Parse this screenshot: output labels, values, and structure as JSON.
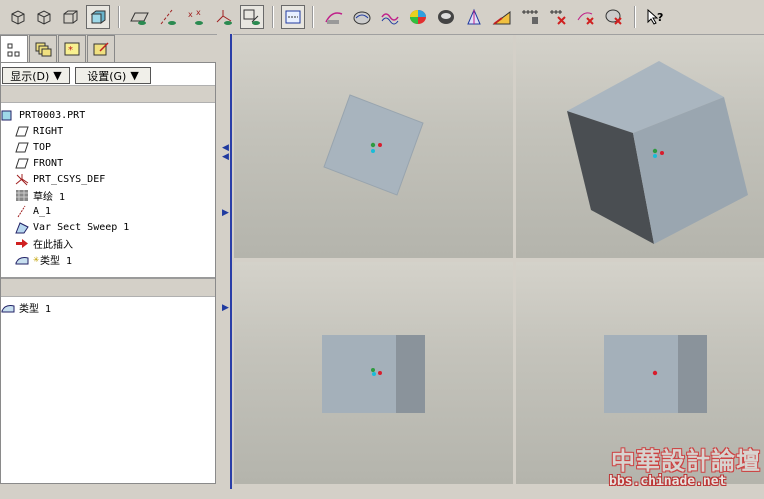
{
  "toolbar": {
    "items": [
      "view-iso-icon",
      "view-iso2-icon",
      "wireframe-icon",
      "shaded-icon",
      "datum-planes-icon",
      "datum-axes-icon",
      "datum-points-icon",
      "csys-icon",
      "spin-center-icon",
      "window-layout-icon",
      "sketch-tool-icon",
      "curve-analysis-icon",
      "curvature-icon",
      "shade-analysis-icon",
      "dihedral-icon",
      "draft-icon",
      "slope-icon",
      "measure-icon",
      "delete-analysis-icon",
      "delete-all-icon",
      "whats-this-help-icon"
    ]
  },
  "tabs": [
    "model-tree-tab",
    "layers-tab",
    "favorites-tab",
    "web-tab"
  ],
  "panel": {
    "display_label": "显示(D)",
    "settings_label": "设置(G)"
  },
  "tree": [
    {
      "label": "PRT0003.PRT",
      "icon": "part-icon"
    },
    {
      "label": "RIGHT",
      "icon": "datum-plane-icon"
    },
    {
      "label": "TOP",
      "icon": "datum-plane-icon"
    },
    {
      "label": "FRONT",
      "icon": "datum-plane-icon"
    },
    {
      "label": "PRT_CSYS_DEF",
      "icon": "csys-icon"
    },
    {
      "label": "草绘 1",
      "icon": "sketch-icon"
    },
    {
      "label": "A_1",
      "icon": "axis-icon"
    },
    {
      "label": "Var Sect Sweep 1",
      "icon": "sweep-icon"
    },
    {
      "label": "在此插入",
      "icon": "insert-here-icon"
    },
    {
      "label": "类型 1",
      "icon": "surface-type-icon"
    }
  ],
  "lower_list": [
    {
      "label": "类型 1",
      "icon": "surface-type-icon"
    }
  ],
  "watermark": {
    "cn": "中華設計論壇",
    "url": "bbs.chinade.net"
  },
  "colors": {
    "face_top": "#a4b0ba",
    "face_front": "#8e9aa4",
    "face_dark": "#4a4e52",
    "accent_blue": "#1f3aa0"
  }
}
